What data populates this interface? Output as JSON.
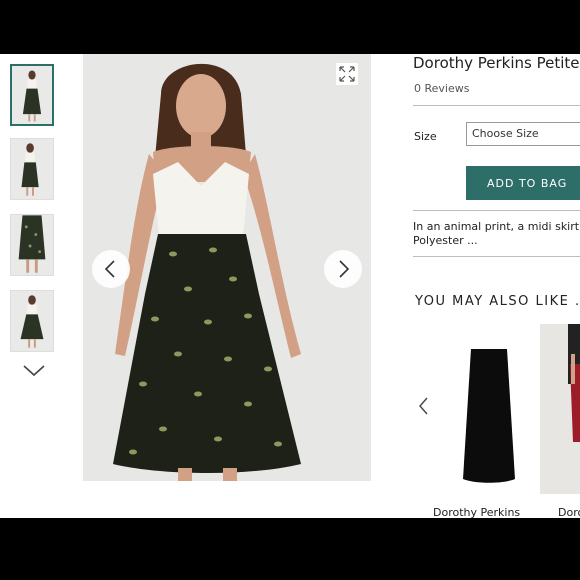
{
  "product": {
    "title": "Dorothy Perkins Petite",
    "reviews": "0 Reviews",
    "size_label": "Size",
    "size_placeholder": "Choose Size",
    "add_to_bag": "ADD TO BAG",
    "description_line1": "In an animal print, a midi skirt fr",
    "description_line2": "Polyester ..."
  },
  "recommendations": {
    "heading": "YOU MAY ALSO LIKE . . .",
    "items": [
      {
        "name": "Dorothy Perkins"
      },
      {
        "name": "Doro"
      }
    ]
  },
  "icons": {
    "expand": "expand-arrows-icon",
    "prev": "chevron-left-icon",
    "next": "chevron-right-icon",
    "thumbs_down": "chevron-down-icon"
  },
  "colors": {
    "accent": "#2e6e69",
    "skirt": "#1e2118",
    "print": "#8a9a5e",
    "top": "#f4f3ee",
    "background": "#e7e7e5"
  }
}
